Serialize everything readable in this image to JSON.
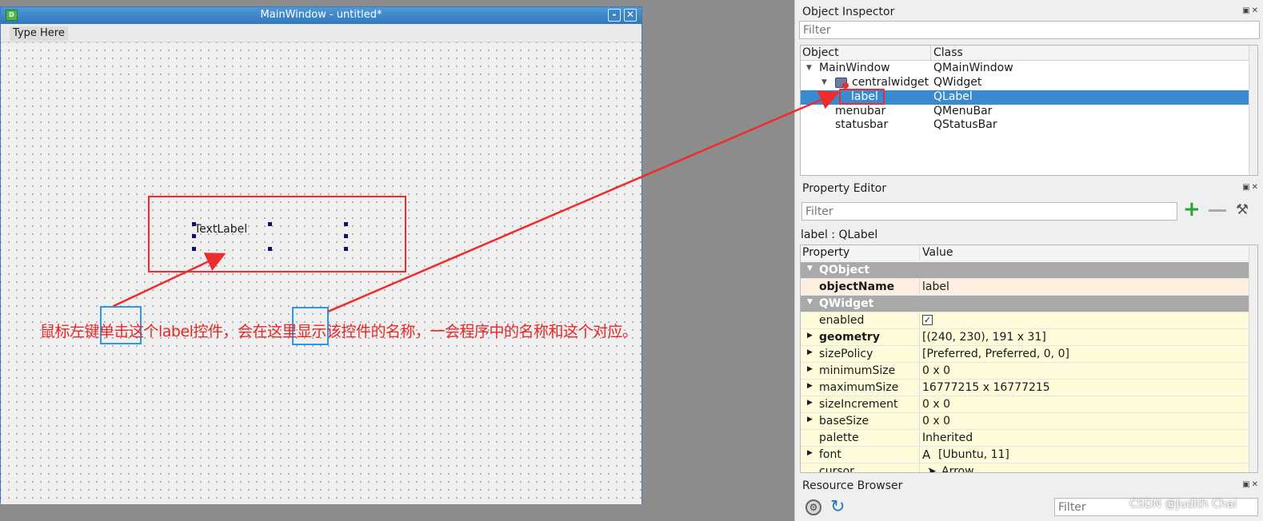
{
  "form": {
    "title": "MainWindow - untitled*",
    "icon": "D",
    "minimize_label": "-",
    "close_label": "✕",
    "menu_placeholder": "Type Here",
    "label_text": "TextLabel"
  },
  "object_inspector": {
    "title": "Object Inspector",
    "filter_placeholder": "Filter",
    "columns": [
      "Object",
      "Class"
    ],
    "rows": [
      {
        "object": "MainWindow",
        "class": "QMainWindow"
      },
      {
        "object": "centralwidget",
        "class": "QWidget"
      },
      {
        "object": "label",
        "class": "QLabel"
      },
      {
        "object": "menubar",
        "class": "QMenuBar"
      },
      {
        "object": "statusbar",
        "class": "QStatusBar"
      }
    ]
  },
  "property_editor": {
    "title": "Property Editor",
    "filter_placeholder": "Filter",
    "add_label": "+",
    "context": "label : QLabel",
    "columns": [
      "Property",
      "Value"
    ],
    "rows": [
      {
        "key": "QObject",
        "value": ""
      },
      {
        "key": "objectName",
        "value": "label"
      },
      {
        "key": "QWidget",
        "value": ""
      },
      {
        "key": "enabled",
        "value": "✓"
      },
      {
        "key": "geometry",
        "value": "[(240, 230), 191 x 31]"
      },
      {
        "key": "sizePolicy",
        "value": "[Preferred, Preferred, 0, 0]"
      },
      {
        "key": "minimumSize",
        "value": "0 x 0"
      },
      {
        "key": "maximumSize",
        "value": "16777215 x 16777215"
      },
      {
        "key": "sizeIncrement",
        "value": "0 x 0"
      },
      {
        "key": "baseSize",
        "value": "0 x 0"
      },
      {
        "key": "palette",
        "value": "Inherited"
      },
      {
        "key": "font",
        "value": "[Ubuntu, 11]"
      },
      {
        "key": "cursor",
        "value": "Arrow"
      }
    ],
    "font_glyph": "A"
  },
  "resource_browser": {
    "title": "Resource Browser",
    "filter_placeholder": "Filter"
  },
  "annotation": {
    "text": "鼠标左键单击这个label控件，会在这里显示该控件的名称，一会程序中的名称和这个对应。",
    "color": "#ea2525"
  },
  "watermark": "CSDN @Judith Chai",
  "colors": {
    "selection": "#3a8ad2",
    "titlebar": "#2f78bd",
    "annotation_box_red": "#ee2c2c",
    "annotation_box_blue": "#2a98ec"
  }
}
